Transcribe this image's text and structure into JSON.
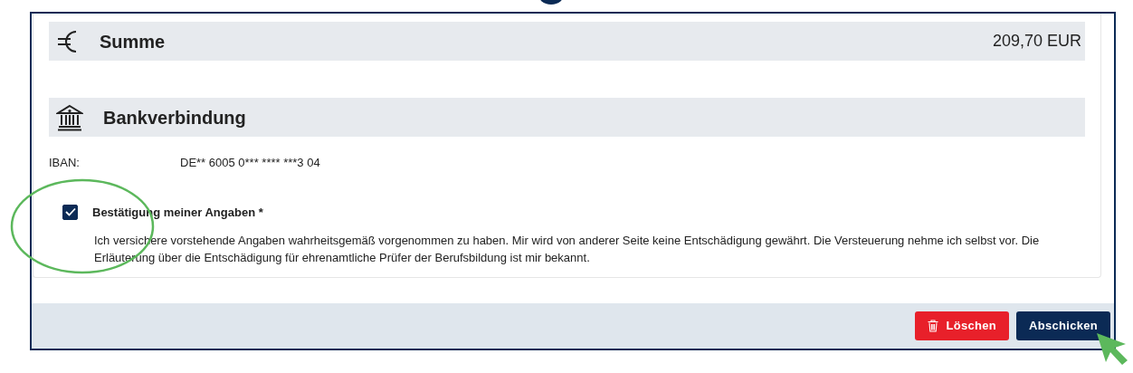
{
  "sum_section": {
    "title": "Summe",
    "amount": "209,70 EUR"
  },
  "bank_section": {
    "title": "Bankverbindung",
    "fields": [
      {
        "label": "IBAN:",
        "value": "DE** 6005 0*** **** ***3 04"
      }
    ]
  },
  "confirmation": {
    "label": "Bestätigung meiner Angaben *",
    "checked": true,
    "text": "Ich versichere vorstehende Angaben wahrheitsgemäß vorgenommen zu haben. Mir wird von anderer Seite keine Entschädigung gewährt. Die Versteuerung nehme ich selbst vor. Die Erläuterung über die Entschädigung für ehrenamtliche Prüfer der Berufsbildung ist mir bekannt."
  },
  "buttons": [
    {
      "label": "Löschen",
      "kind": "delete"
    },
    {
      "label": "Abschicken",
      "kind": "submit"
    }
  ]
}
